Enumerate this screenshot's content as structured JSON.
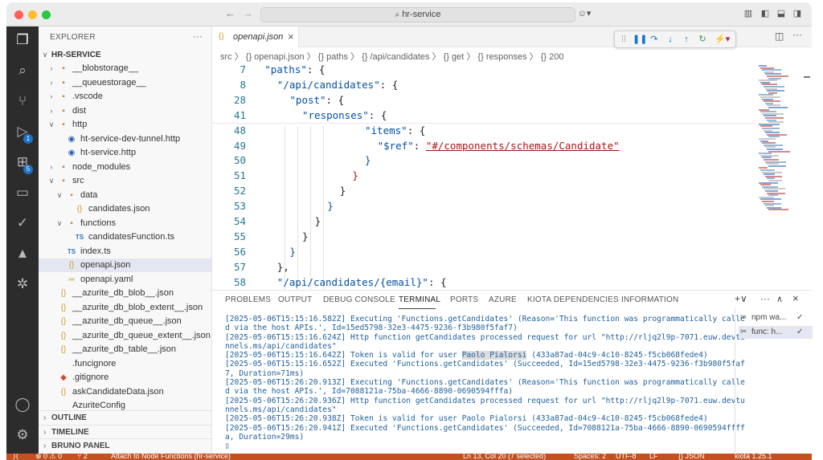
{
  "titlebar": {
    "search": "hr-service"
  },
  "sidebar": {
    "title": "EXPLORER",
    "more": "···",
    "root": "HR-SERVICE",
    "items": [
      {
        "label": "__blobstorage__",
        "level": 1,
        "type": "folder",
        "open": false
      },
      {
        "label": "__queuestorage__",
        "level": 1,
        "type": "folder",
        "open": false
      },
      {
        "label": ".vscode",
        "level": 1,
        "type": "folder",
        "open": false
      },
      {
        "label": "dist",
        "level": 1,
        "type": "folder",
        "open": false
      },
      {
        "label": "http",
        "level": 1,
        "type": "folder",
        "open": true
      },
      {
        "label": "ht-service-dev-tunnel.http",
        "level": 2,
        "type": "http"
      },
      {
        "label": "ht-service.http",
        "level": 2,
        "type": "http"
      },
      {
        "label": "node_modules",
        "level": 1,
        "type": "folder",
        "open": false
      },
      {
        "label": "src",
        "level": 1,
        "type": "folder",
        "open": true
      },
      {
        "label": "data",
        "level": 2,
        "type": "folder",
        "open": true
      },
      {
        "label": "candidates.json",
        "level": 3,
        "type": "json"
      },
      {
        "label": "functions",
        "level": 2,
        "type": "folder",
        "open": true
      },
      {
        "label": "candidatesFunction.ts",
        "level": 3,
        "type": "ts"
      },
      {
        "label": "index.ts",
        "level": 2,
        "type": "ts"
      },
      {
        "label": "openapi.json",
        "level": 2,
        "type": "json",
        "selected": true
      },
      {
        "label": "openapi.yaml",
        "level": 2,
        "type": "yaml"
      },
      {
        "label": "__azurite_db_blob__.json",
        "level": 1,
        "type": "json"
      },
      {
        "label": "__azurite_db_blob_extent__.json",
        "level": 1,
        "type": "json"
      },
      {
        "label": "__azurite_db_queue__.json",
        "level": 1,
        "type": "json"
      },
      {
        "label": "__azurite_db_queue_extent__.json",
        "level": 1,
        "type": "json"
      },
      {
        "label": "__azurite_db_table__.json",
        "level": 1,
        "type": "json"
      },
      {
        "label": ".funcignore",
        "level": 1,
        "type": "file"
      },
      {
        "label": ".gitignore",
        "level": 1,
        "type": "git"
      },
      {
        "label": "askCandidateData.json",
        "level": 1,
        "type": "json"
      },
      {
        "label": "AzuriteConfig",
        "level": 1,
        "type": "file"
      }
    ],
    "sections": [
      "OUTLINE",
      "TIMELINE",
      "BRUNO PANEL"
    ]
  },
  "activity": {
    "badges": [
      "1",
      "5"
    ]
  },
  "editor": {
    "tab_label": "openapi.json",
    "tab_close": "×",
    "breadcrumb": "src 〉 {} openapi.json 〉 {} paths 〉 {} /api/candidates 〉 {} get 〉 {} responses 〉 {} 200",
    "lines": [
      {
        "n": "7",
        "indent": 2,
        "parts": [
          {
            "t": "\"paths\"",
            "c": "key"
          },
          {
            "t": ": {",
            "c": "pun"
          }
        ]
      },
      {
        "n": "8",
        "indent": 3,
        "parts": [
          {
            "t": "\"/api/candidates\"",
            "c": "key"
          },
          {
            "t": ": {",
            "c": "pun"
          }
        ]
      },
      {
        "n": "28",
        "indent": 4,
        "parts": [
          {
            "t": "\"post\"",
            "c": "key"
          },
          {
            "t": ": {",
            "c": "pun"
          }
        ]
      },
      {
        "n": "41",
        "indent": 5,
        "parts": [
          {
            "t": "\"responses\"",
            "c": "key"
          },
          {
            "t": ": {",
            "c": "pun"
          }
        ]
      },
      {
        "n": "48",
        "indent": 10,
        "parts": [
          {
            "t": "\"items\"",
            "c": "key"
          },
          {
            "t": ": {",
            "c": "pun"
          }
        ]
      },
      {
        "n": "49",
        "indent": 11,
        "parts": [
          {
            "t": "\"$ref\"",
            "c": "key"
          },
          {
            "t": ": ",
            "c": "pun"
          },
          {
            "t": "\"#/components/schemas/Candidate\"",
            "c": "str"
          }
        ]
      },
      {
        "n": "50",
        "indent": 10,
        "parts": [
          {
            "t": "}",
            "c": "key"
          }
        ]
      },
      {
        "n": "51",
        "indent": 9,
        "parts": [
          {
            "t": "}",
            "c": "str"
          }
        ]
      },
      {
        "n": "52",
        "indent": 8,
        "parts": [
          {
            "t": "}",
            "c": "pun"
          }
        ]
      },
      {
        "n": "53",
        "indent": 7,
        "parts": [
          {
            "t": "}",
            "c": "key"
          }
        ]
      },
      {
        "n": "54",
        "indent": 6,
        "parts": [
          {
            "t": "}",
            "c": "pun"
          }
        ]
      },
      {
        "n": "55",
        "indent": 5,
        "parts": [
          {
            "t": "}",
            "c": "pun"
          }
        ]
      },
      {
        "n": "56",
        "indent": 4,
        "parts": [
          {
            "t": "}",
            "c": "key"
          }
        ]
      },
      {
        "n": "57",
        "indent": 3,
        "parts": [
          {
            "t": "},",
            "c": "pun"
          }
        ]
      },
      {
        "n": "58",
        "indent": 3,
        "parts": [
          {
            "t": "\"/api/candidates/{email}\"",
            "c": "key"
          },
          {
            "t": ": {",
            "c": "pun"
          }
        ]
      }
    ]
  },
  "panel": {
    "tabs": [
      "PROBLEMS",
      "OUTPUT",
      "DEBUG CONSOLE",
      "TERMINAL",
      "PORTS",
      "AZURE",
      "KIOTA DEPENDENCIES INFORMATION"
    ],
    "active_tab": "TERMINAL",
    "actions": [
      "+∨",
      "···",
      "∧",
      "×"
    ],
    "terminal_lines": [
      "[2025-05-06T15:15:16.582Z] Executing 'Functions.getCandidates' (Reason='This function was programmatically calle",
      "d via the host APIs.', Id=15ed5798-32e3-4475-9236-f3b980f5faf7)",
      "[2025-05-06T15:15:16.624Z] Http function getCandidates processed request for url \"http://rljq2l9p-7071.euw.devtu",
      "nnels.ms/api/candidates\"",
      "[2025-05-06T15:15:16.642Z] Token is valid for user Paolo Pialorsi (433a87ad-04c9-4c10-8245-f5cb068fede4)",
      "[2025-05-06T15:15:16.652Z] Executed 'Functions.getCandidates' (Succeeded, Id=15ed5798-32e3-4475-9236-f3b980f5faf",
      "7, Duration=71ms)",
      "[2025-05-06T15:26:20.913Z] Executing 'Functions.getCandidates' (Reason='This function was programmatically calle",
      "d via the host APIs.', Id=7088121a-75ba-4666-8890-0690594fffa)",
      "[2025-05-06T15:26:20.936Z] Http function getCandidates processed request for url \"http://rljq2l9p-7071.euw.devtu",
      "nnels.ms/api/candidates\"",
      "[2025-05-06T15:26:20.938Z] Token is valid for user Paolo Pialorsi (433a87ad-04c9-4c10-8245-f5cb068fede4)",
      "[2025-05-06T15:26:20.941Z] Executed 'Functions.getCandidates' (Succeeded, Id=7088121a-75ba-4666-8890-0690594ffff",
      "a, Duration=29ms)",
      "▯"
    ],
    "terminals": [
      {
        "label": "npm wa...",
        "check": "✓"
      },
      {
        "label": "func: h...",
        "check": "✓"
      }
    ]
  },
  "statusbar": {
    "items": [
      "⊗ 0 ⚠ 0",
      "⑂ 2",
      "Attach to Node Functions (hr-service)",
      "Ln 13, Col 20 (7 selected)",
      "Spaces: 2",
      "UTF-8",
      "LF",
      "{} JSON",
      "kiota 1.25.1"
    ]
  },
  "colors": {
    "statusbar": "#c4501f",
    "activity": "#2c2c2c",
    "accent": "#1d74c6"
  }
}
